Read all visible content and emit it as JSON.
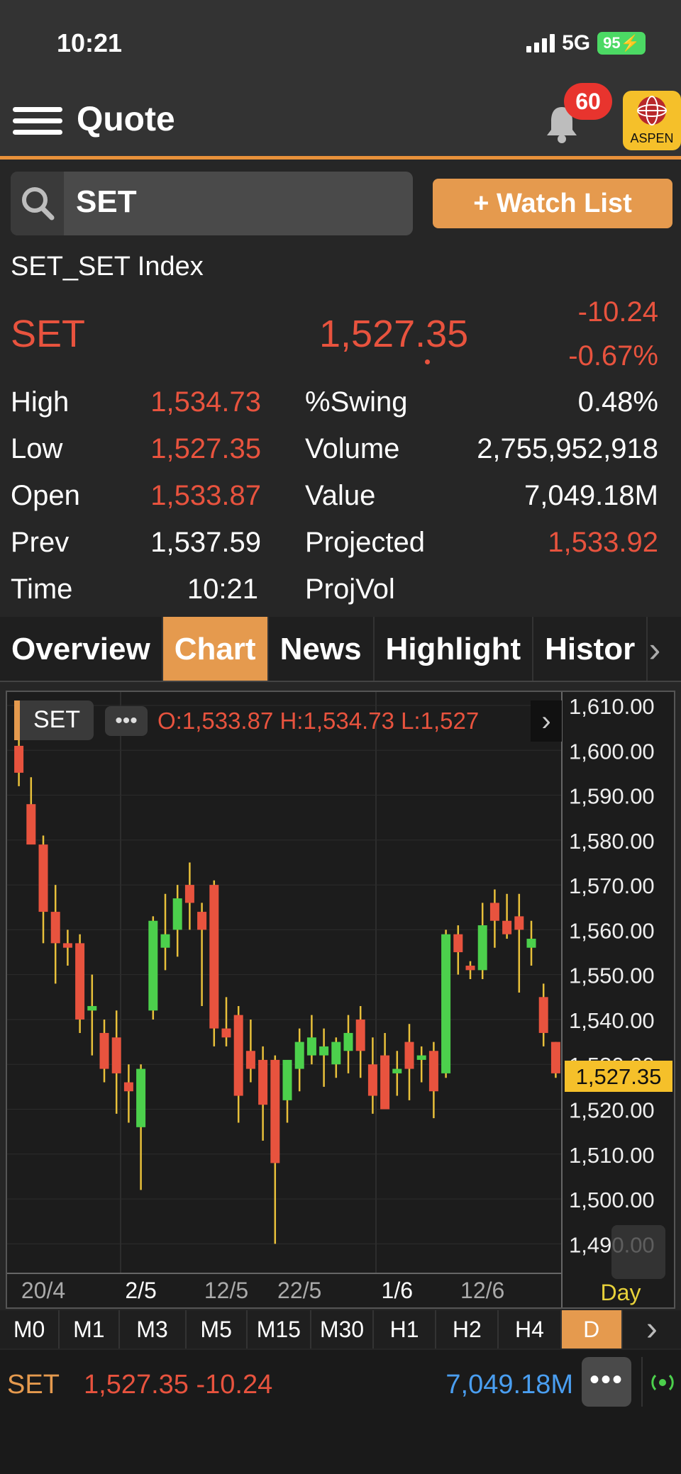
{
  "status": {
    "time": "10:21",
    "network": "5G",
    "battery": "95"
  },
  "header": {
    "title": "Quote",
    "notification_count": "60",
    "brand": "ASPEN"
  },
  "search": {
    "value": "SET",
    "watch_label": "+ Watch List"
  },
  "quote": {
    "full_name": "SET_SET Index",
    "symbol": "SET",
    "last": "1,527.35",
    "change": "-10.24",
    "pct_change": "-0.67%"
  },
  "stats_left": [
    {
      "label": "High",
      "value": "1,534.73",
      "color": "red"
    },
    {
      "label": "Low",
      "value": "1,527.35",
      "color": "red"
    },
    {
      "label": "Open",
      "value": "1,533.87",
      "color": "red"
    },
    {
      "label": "Prev",
      "value": "1,537.59",
      "color": "white"
    },
    {
      "label": "Time",
      "value": "10:21",
      "color": "white"
    }
  ],
  "stats_right": [
    {
      "label": "%Swing",
      "value": "0.48%",
      "color": "white"
    },
    {
      "label": "Volume",
      "value": "2,755,952,918",
      "color": "white"
    },
    {
      "label": "Value",
      "value": "7,049.18M",
      "color": "white"
    },
    {
      "label": "Projected",
      "value": "1,533.92",
      "color": "red"
    },
    {
      "label": "ProjVol",
      "value": "",
      "color": "white"
    }
  ],
  "tabs": [
    {
      "label": "Overview",
      "active": false
    },
    {
      "label": "Chart",
      "active": true
    },
    {
      "label": "News",
      "active": false
    },
    {
      "label": "Highlight",
      "active": false
    },
    {
      "label": "Histor",
      "active": false
    }
  ],
  "chart_header": {
    "symbol": "SET",
    "ohlc": "O:1,533.87  H:1,534.73  L:1,527"
  },
  "colors": {
    "up": "#4cd04c",
    "down": "#e8533e",
    "wick": "#e8c03a",
    "accent": "#e59a4e",
    "price_tag": "#f5c02a"
  },
  "chart_data": {
    "type": "candlestick",
    "ylim": [
      1485,
      1613
    ],
    "y_ticks": [
      "1,610.00",
      "1,600.00",
      "1,590.00",
      "1,580.00",
      "1,570.00",
      "1,560.00",
      "1,550.00",
      "1,540.00",
      "1,530.00",
      "1,520.00",
      "1,510.00",
      "1,500.00",
      "1,490.00"
    ],
    "y_tick_values": [
      1610,
      1600,
      1590,
      1580,
      1570,
      1560,
      1550,
      1540,
      1530,
      1520,
      1510,
      1500,
      1490
    ],
    "x_labels": [
      "20/4",
      "2/5",
      "12/5",
      "22/5",
      "1/6",
      "12/6"
    ],
    "x_label_index": [
      2,
      10,
      17,
      23,
      31,
      38
    ],
    "current_price": "1,527.35",
    "current_value": 1527.35,
    "period_label": "Day",
    "candles": [
      {
        "o": 1601,
        "h": 1603,
        "l": 1592,
        "c": 1595
      },
      {
        "o": 1588,
        "h": 1594,
        "l": 1582,
        "c": 1579
      },
      {
        "o": 1579,
        "h": 1581,
        "l": 1557,
        "c": 1564
      },
      {
        "o": 1564,
        "h": 1570,
        "l": 1548,
        "c": 1557
      },
      {
        "o": 1557,
        "h": 1560,
        "l": 1552,
        "c": 1556
      },
      {
        "o": 1557,
        "h": 1559,
        "l": 1537,
        "c": 1540
      },
      {
        "o": 1542,
        "h": 1550,
        "l": 1532,
        "c": 1543
      },
      {
        "o": 1537,
        "h": 1540,
        "l": 1526,
        "c": 1529
      },
      {
        "o": 1536,
        "h": 1542,
        "l": 1519,
        "c": 1528
      },
      {
        "o": 1526,
        "h": 1530,
        "l": 1517,
        "c": 1524
      },
      {
        "o": 1516,
        "h": 1530,
        "l": 1502,
        "c": 1529
      },
      {
        "o": 1542,
        "h": 1563,
        "l": 1540,
        "c": 1562
      },
      {
        "o": 1556,
        "h": 1568,
        "l": 1551,
        "c": 1559
      },
      {
        "o": 1560,
        "h": 1570,
        "l": 1554,
        "c": 1567
      },
      {
        "o": 1570,
        "h": 1575,
        "l": 1560,
        "c": 1566
      },
      {
        "o": 1564,
        "h": 1566,
        "l": 1543,
        "c": 1560
      },
      {
        "o": 1570,
        "h": 1571,
        "l": 1534,
        "c": 1538
      },
      {
        "o": 1538,
        "h": 1545,
        "l": 1534,
        "c": 1536
      },
      {
        "o": 1541,
        "h": 1543,
        "l": 1517,
        "c": 1523
      },
      {
        "o": 1533,
        "h": 1540,
        "l": 1526,
        "c": 1529
      },
      {
        "o": 1531,
        "h": 1534,
        "l": 1513,
        "c": 1521
      },
      {
        "o": 1531,
        "h": 1532,
        "l": 1490,
        "c": 1508
      },
      {
        "o": 1522,
        "h": 1529,
        "l": 1517,
        "c": 1531
      },
      {
        "o": 1529,
        "h": 1538,
        "l": 1524,
        "c": 1535
      },
      {
        "o": 1532,
        "h": 1541,
        "l": 1530,
        "c": 1536
      },
      {
        "o": 1532,
        "h": 1538,
        "l": 1525,
        "c": 1534
      },
      {
        "o": 1530,
        "h": 1536,
        "l": 1527,
        "c": 1535
      },
      {
        "o": 1533,
        "h": 1541,
        "l": 1528,
        "c": 1537
      },
      {
        "o": 1540,
        "h": 1543,
        "l": 1527,
        "c": 1533
      },
      {
        "o": 1530,
        "h": 1536,
        "l": 1519,
        "c": 1523
      },
      {
        "o": 1532,
        "h": 1537,
        "l": 1520,
        "c": 1520
      },
      {
        "o": 1528,
        "h": 1533,
        "l": 1523,
        "c": 1529
      },
      {
        "o": 1535,
        "h": 1539,
        "l": 1522,
        "c": 1529
      },
      {
        "o": 1531,
        "h": 1534,
        "l": 1526,
        "c": 1532
      },
      {
        "o": 1533,
        "h": 1535,
        "l": 1518,
        "c": 1524
      },
      {
        "o": 1528,
        "h": 1560,
        "l": 1527,
        "c": 1559
      },
      {
        "o": 1559,
        "h": 1561,
        "l": 1550,
        "c": 1555
      },
      {
        "o": 1552,
        "h": 1553,
        "l": 1549,
        "c": 1551
      },
      {
        "o": 1551,
        "h": 1566,
        "l": 1549,
        "c": 1561
      },
      {
        "o": 1566,
        "h": 1569,
        "l": 1556,
        "c": 1562
      },
      {
        "o": 1562,
        "h": 1568,
        "l": 1558,
        "c": 1559
      },
      {
        "o": 1563,
        "h": 1568,
        "l": 1546,
        "c": 1560
      },
      {
        "o": 1556,
        "h": 1562,
        "l": 1552,
        "c": 1558
      },
      {
        "o": 1545,
        "h": 1548,
        "l": 1534,
        "c": 1537
      },
      {
        "o": 1535,
        "h": 1535,
        "l": 1527,
        "c": 1528
      }
    ]
  },
  "timeframes": [
    {
      "label": "M0",
      "active": false
    },
    {
      "label": "M1",
      "active": false
    },
    {
      "label": "M3",
      "active": false
    },
    {
      "label": "M5",
      "active": false
    },
    {
      "label": "M15",
      "active": false
    },
    {
      "label": "M30",
      "active": false
    },
    {
      "label": "H1",
      "active": false
    },
    {
      "label": "H2",
      "active": false
    },
    {
      "label": "H4",
      "active": false
    },
    {
      "label": "D",
      "active": true
    }
  ],
  "footer": {
    "symbol": "SET",
    "price_change": "1,527.35 -10.24",
    "value": "7,049.18M"
  }
}
